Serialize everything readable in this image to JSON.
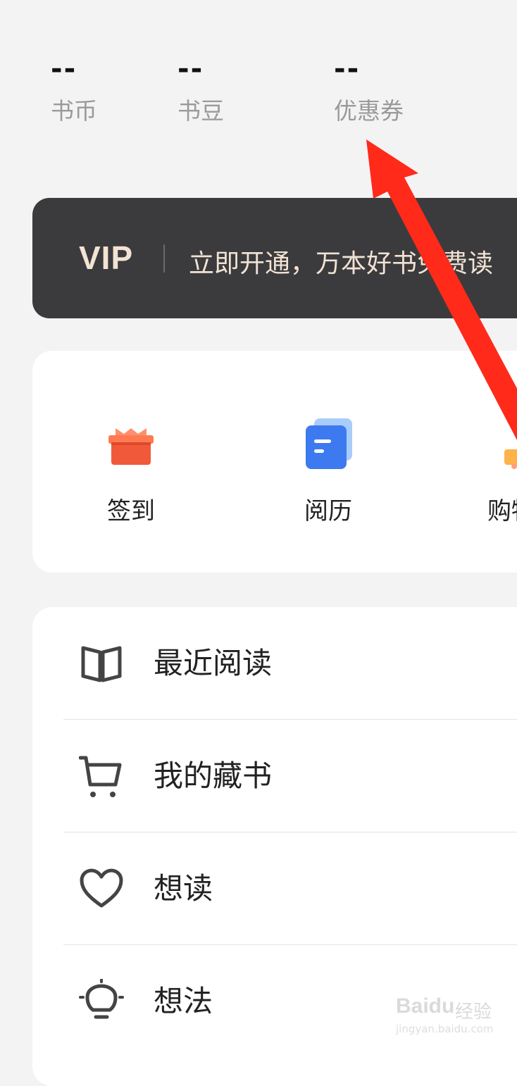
{
  "stats": [
    {
      "value": "--",
      "label": "书币"
    },
    {
      "value": "--",
      "label": "书豆"
    },
    {
      "value": "--",
      "label": "优惠券"
    }
  ],
  "vip": {
    "logo": "VIP",
    "text": "立即开通，万本好书免费读"
  },
  "quick_actions": [
    {
      "label": "签到",
      "icon": "gift-icon"
    },
    {
      "label": "阅历",
      "icon": "reading-history-icon"
    },
    {
      "label": "购物",
      "icon": "shopping-icon"
    }
  ],
  "menu": [
    {
      "label": "最近阅读",
      "icon": "open-book-icon"
    },
    {
      "label": "我的藏书",
      "icon": "shopping-cart-icon"
    },
    {
      "label": "想读",
      "icon": "heart-icon"
    },
    {
      "label": "想法",
      "icon": "lightbulb-icon"
    }
  ],
  "watermark": {
    "brand": "Baidu",
    "cn": "经验",
    "url": "jingyan.baidu.com"
  },
  "colors": {
    "background": "#f3f3f3",
    "vip_bg": "#3b3b3d",
    "vip_text": "#f1e2d4",
    "gift_red": "#f05a3a",
    "doc_blue": "#3d7af0",
    "annotation_arrow": "#ff2a1a"
  }
}
